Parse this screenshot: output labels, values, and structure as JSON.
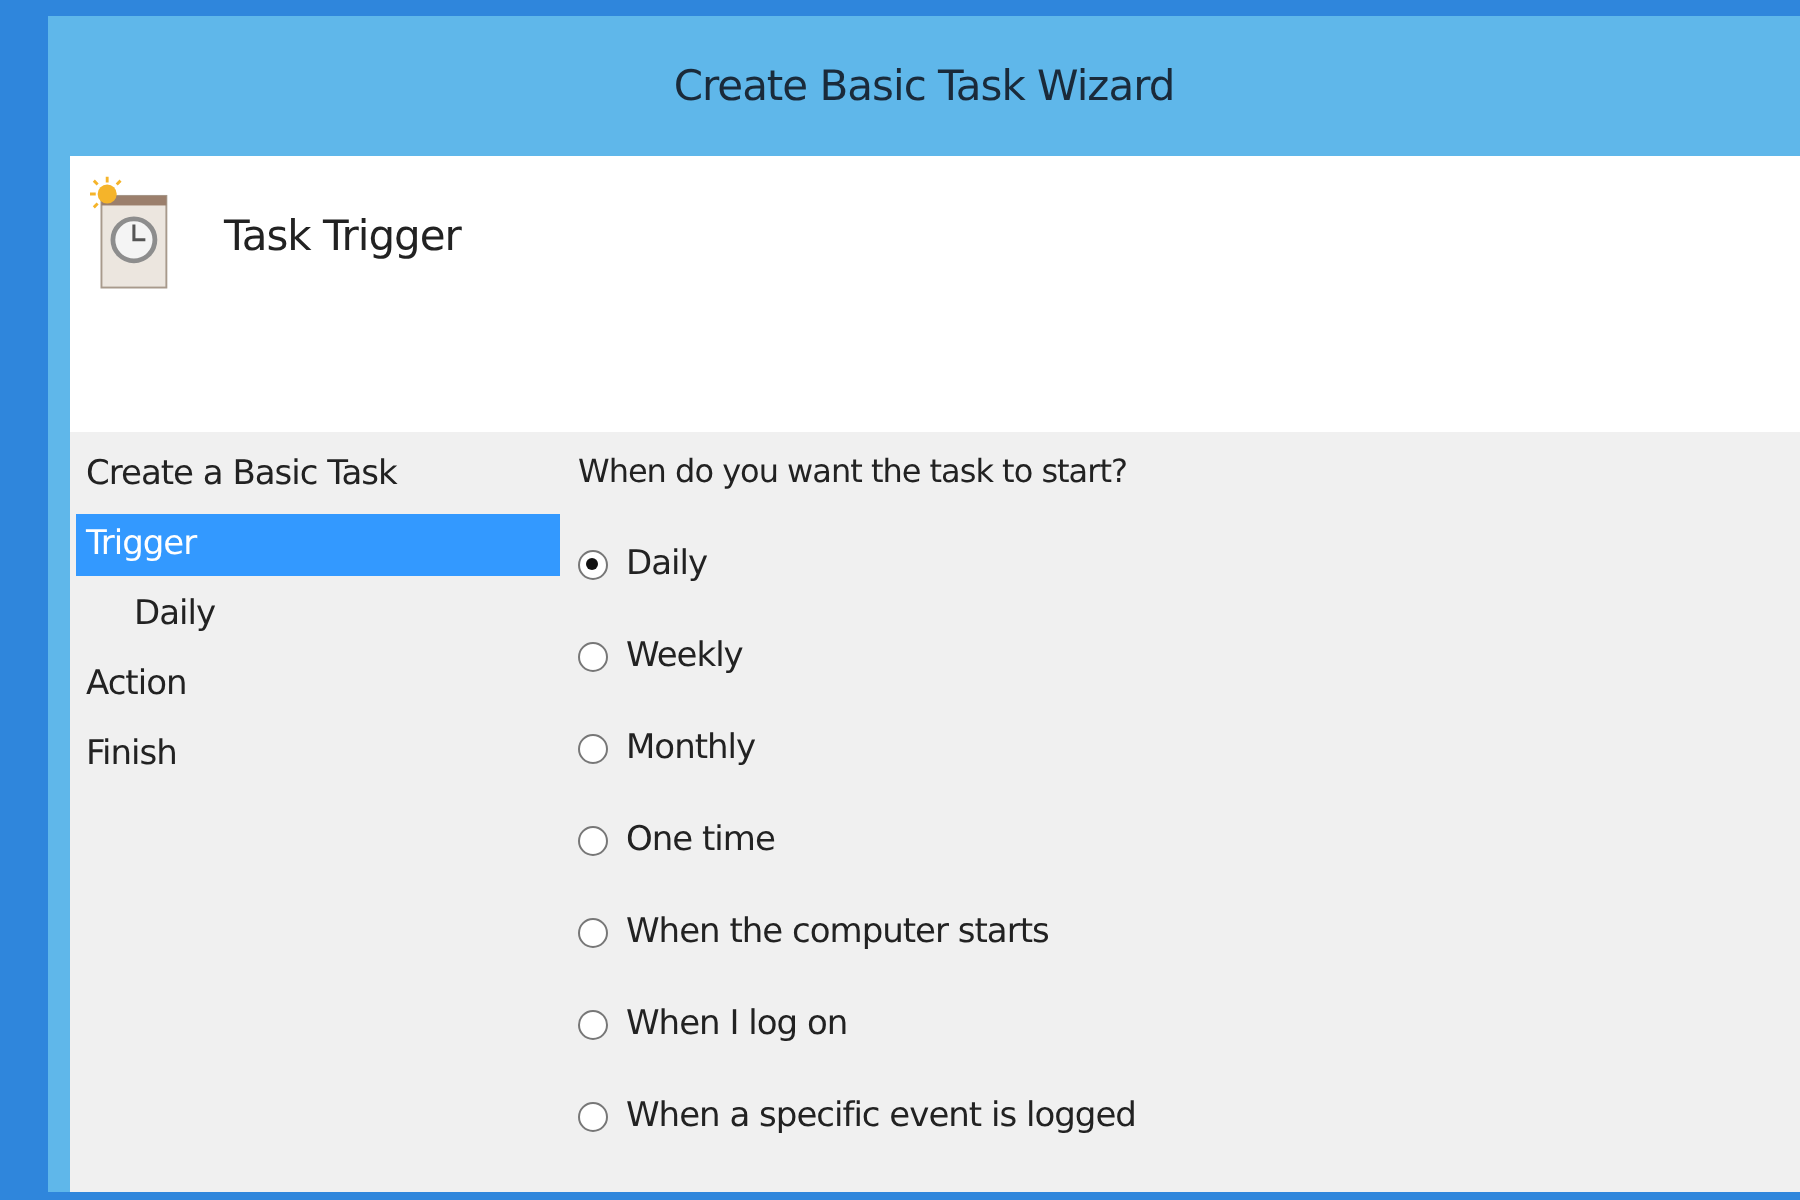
{
  "window": {
    "title": "Create Basic Task Wizard"
  },
  "header": {
    "title": "Task Trigger"
  },
  "sidebar": {
    "items": [
      {
        "label": "Create a Basic Task",
        "selected": false
      },
      {
        "label": "Trigger",
        "selected": true,
        "children": [
          {
            "label": "Daily",
            "selected": false
          }
        ]
      },
      {
        "label": "Action",
        "selected": false
      },
      {
        "label": "Finish",
        "selected": false
      }
    ]
  },
  "question": "When do you want the task to start?",
  "options": [
    {
      "label": "Daily",
      "selected": true
    },
    {
      "label": "Weekly",
      "selected": false
    },
    {
      "label": "Monthly",
      "selected": false
    },
    {
      "label": "One time",
      "selected": false
    },
    {
      "label": "When the computer starts",
      "selected": false
    },
    {
      "label": "When I log on",
      "selected": false
    },
    {
      "label": "When a specific event is logged",
      "selected": false
    }
  ]
}
